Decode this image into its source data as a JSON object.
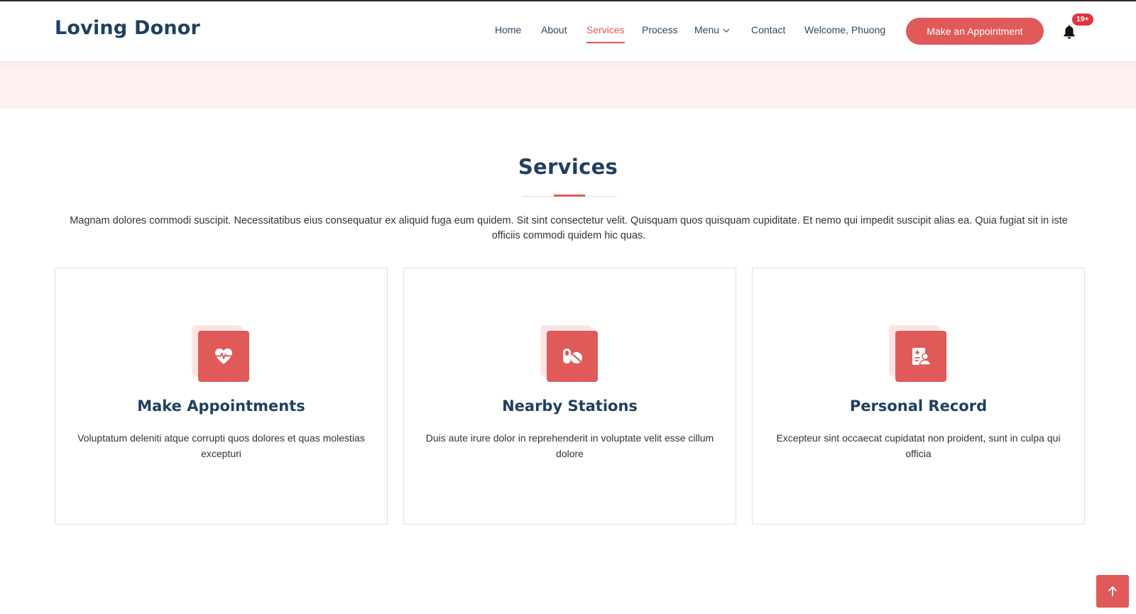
{
  "brand": {
    "name": "Loving Donor"
  },
  "nav": {
    "items": [
      {
        "label": "Home"
      },
      {
        "label": "About"
      },
      {
        "label": "Services",
        "active": true
      },
      {
        "label": "Process"
      },
      {
        "label": "Menu",
        "has_dropdown": true
      },
      {
        "label": "Contact"
      },
      {
        "label": "Welcome, Phuong"
      }
    ],
    "cta_label": "Make an Appointment",
    "notifications": {
      "icon": "bell-icon",
      "badge": "19+"
    }
  },
  "services": {
    "title": "Services",
    "description": "Magnam dolores commodi suscipit. Necessitatibus eius consequatur ex aliquid fuga eum quidem. Sit sint consectetur velit. Quisquam quos quisquam cupiditate. Et nemo qui impedit suscipit alias ea. Quia fugiat sit in iste officiis commodi quidem hic quas.",
    "cards": [
      {
        "icon": "heart-pulse-icon",
        "title": "Make Appointments",
        "text": "Voluptatum deleniti atque corrupti quos dolores et quas molestias excepturi"
      },
      {
        "icon": "capsules-icon",
        "title": "Nearby Stations",
        "text": "Duis aute irure dolor in reprehenderit in voluptate velit esse cillum dolore"
      },
      {
        "icon": "medical-record-icon",
        "title": "Personal Record",
        "text": "Excepteur sint occaecat cupidatat non proident, sunt in culpa qui officia"
      }
    ]
  },
  "back_to_top": {
    "icon": "arrow-up-icon"
  },
  "colors": {
    "accent": "#e05a5a",
    "heading": "#1f4060",
    "nav_text": "#2c4964",
    "hero_band": "#fdf0ee",
    "card_border": "#d5e5f0"
  }
}
